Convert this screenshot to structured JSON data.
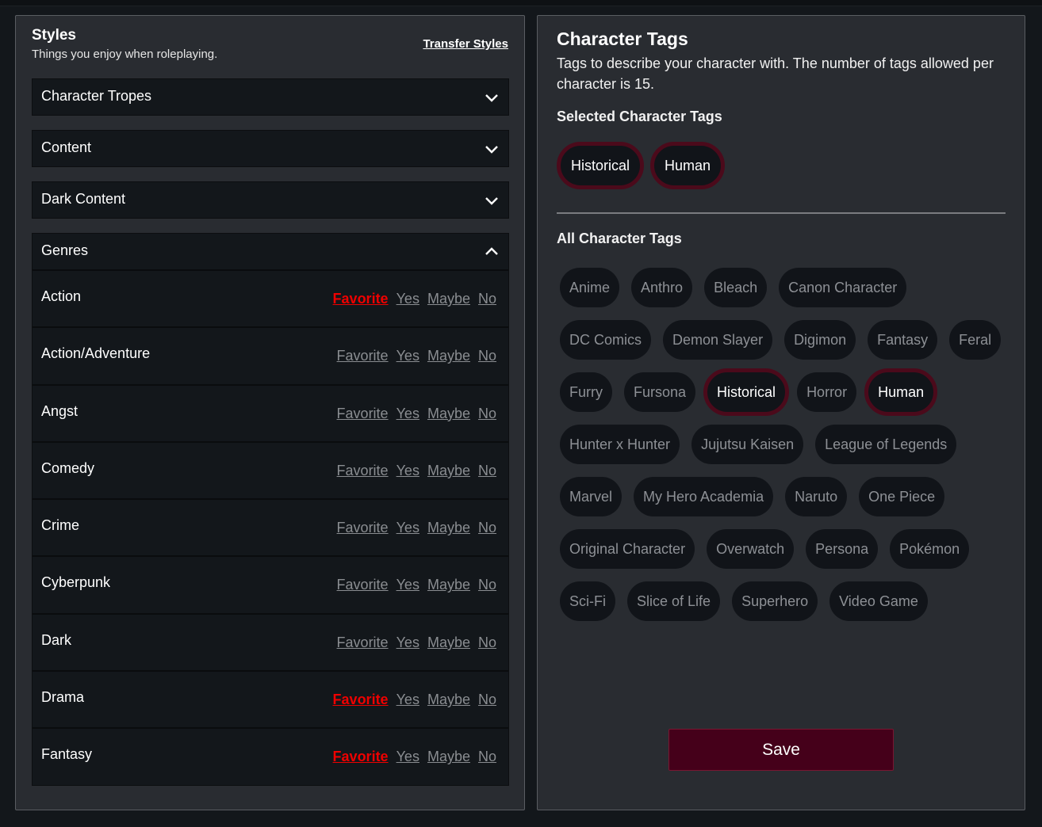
{
  "styles": {
    "title": "Styles",
    "subtitle": "Things you enjoy when roleplaying.",
    "transfer_label": "Transfer Styles",
    "accordions": [
      {
        "label": "Character Tropes",
        "expanded": false
      },
      {
        "label": "Content",
        "expanded": false
      },
      {
        "label": "Dark Content",
        "expanded": false
      },
      {
        "label": "Genres",
        "expanded": true
      }
    ],
    "options": [
      "Favorite",
      "Yes",
      "Maybe",
      "No"
    ],
    "genres": [
      {
        "name": "Action",
        "selected": "Favorite"
      },
      {
        "name": "Action/Adventure",
        "selected": null
      },
      {
        "name": "Angst",
        "selected": null
      },
      {
        "name": "Comedy",
        "selected": null
      },
      {
        "name": "Crime",
        "selected": null
      },
      {
        "name": "Cyberpunk",
        "selected": null
      },
      {
        "name": "Dark",
        "selected": null
      },
      {
        "name": "Drama",
        "selected": "Favorite"
      },
      {
        "name": "Fantasy",
        "selected": "Favorite"
      }
    ]
  },
  "tags": {
    "title": "Character Tags",
    "description": "Tags to describe your character with. The number of tags allowed per character is 15.",
    "selected_label": "Selected Character Tags",
    "all_label": "All Character Tags",
    "selected": [
      "Historical",
      "Human"
    ],
    "all": [
      "Anime",
      "Anthro",
      "Bleach",
      "Canon Character",
      "DC Comics",
      "Demon Slayer",
      "Digimon",
      "Fantasy",
      "Feral",
      "Furry",
      "Fursona",
      "Historical",
      "Horror",
      "Human",
      "Hunter x Hunter",
      "Jujutsu Kaisen",
      "League of Legends",
      "Marvel",
      "My Hero Academia",
      "Naruto",
      "One Piece",
      "Original Character",
      "Overwatch",
      "Persona",
      "Pokémon",
      "Sci-Fi",
      "Slice of Life",
      "Superhero",
      "Video Game"
    ],
    "save_label": "Save"
  },
  "colors": {
    "accent": "#45001a",
    "selected_border": "#4b0a1b",
    "favorite_active": "#ef0000"
  }
}
